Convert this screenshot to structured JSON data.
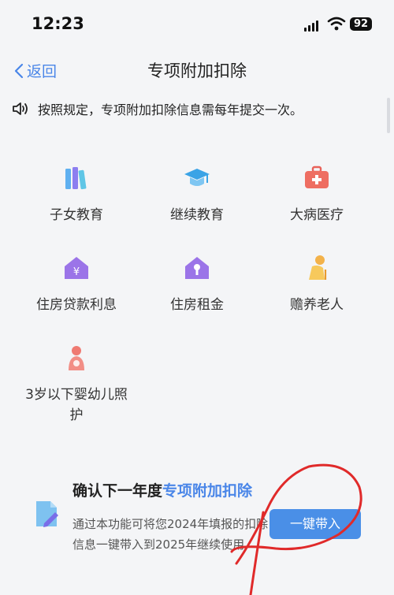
{
  "status": {
    "time": "12:23",
    "battery": "92"
  },
  "nav": {
    "back_label": "返回",
    "title": "专项附加扣除"
  },
  "notice": {
    "text": "按照规定，专项附加扣除信息需每年提交一次。"
  },
  "categories": [
    {
      "label": "子女教育",
      "icon": "books-icon"
    },
    {
      "label": "继续教育",
      "icon": "graduation-cap-icon"
    },
    {
      "label": "大病医疗",
      "icon": "medical-kit-icon"
    },
    {
      "label": "住房贷款利息",
      "icon": "house-yuan-icon"
    },
    {
      "label": "住房租金",
      "icon": "house-key-icon"
    },
    {
      "label": "赡养老人",
      "icon": "elderly-icon"
    },
    {
      "label": "3岁以下婴幼儿照护",
      "icon": "mother-baby-icon"
    }
  ],
  "promo": {
    "title_prefix": "确认下一年度",
    "title_highlight": "专项附加扣除",
    "desc": "通过本功能可将您2024年填报的扣除信息一键带入到2025年继续使用",
    "button": "一键带入"
  },
  "colors": {
    "accent": "#4a86e8",
    "annotation": "#e02a2a"
  }
}
